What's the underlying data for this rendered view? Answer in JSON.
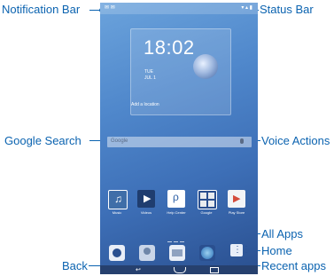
{
  "labels": {
    "notification_bar": "Notification Bar",
    "status_bar": "Status Bar",
    "google_search": "Google Search",
    "voice_actions": "Voice Actions",
    "all_apps": "All Apps",
    "home": "Home",
    "back": "Back",
    "recent_apps": "Recent apps"
  },
  "screen": {
    "clock": "18:02",
    "date_day": "TUE",
    "date_text": "JUL 1",
    "location": "Add a location",
    "search_text": "Google",
    "apps": [
      "Music",
      "Videos",
      "Help Center",
      "Google",
      "Play Store"
    ]
  },
  "colors": {
    "accent": "#0b63b0"
  }
}
